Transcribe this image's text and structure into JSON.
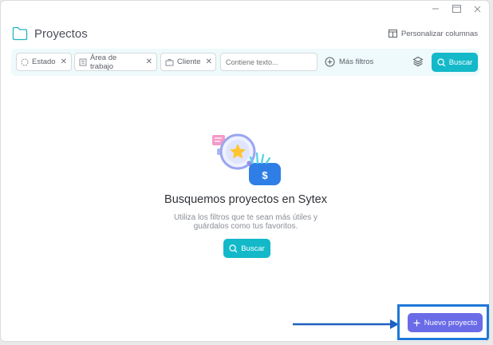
{
  "window": {
    "minimize_icon": "minimize-icon",
    "maximize_icon": "maximize-icon",
    "close_icon": "close-icon"
  },
  "header": {
    "title": "Proyectos",
    "customize_label": "Personalizar columnas"
  },
  "filters": {
    "chips": [
      {
        "label": "Estado",
        "icon": "status-circle-icon"
      },
      {
        "label": "Área de trabajo",
        "icon": "workarea-icon"
      },
      {
        "label": "Cliente",
        "icon": "briefcase-icon"
      }
    ],
    "search_placeholder": "Contiene texto...",
    "more_filters_label": "Más filtros",
    "search_button_label": "Buscar"
  },
  "empty_state": {
    "title": "Busquemos proyectos en Sytex",
    "subtitle_line1": "Utiliza los filtros que te sean más útiles y",
    "subtitle_line2": "guárdalos como tus favoritos.",
    "button_label": "Buscar"
  },
  "actions": {
    "new_project_label": "Nuevo proyecto"
  },
  "colors": {
    "accent": "#13b9c9",
    "primary": "#6b6be8",
    "highlight": "#1f78d7",
    "filterbar_bg": "#eefafb"
  }
}
